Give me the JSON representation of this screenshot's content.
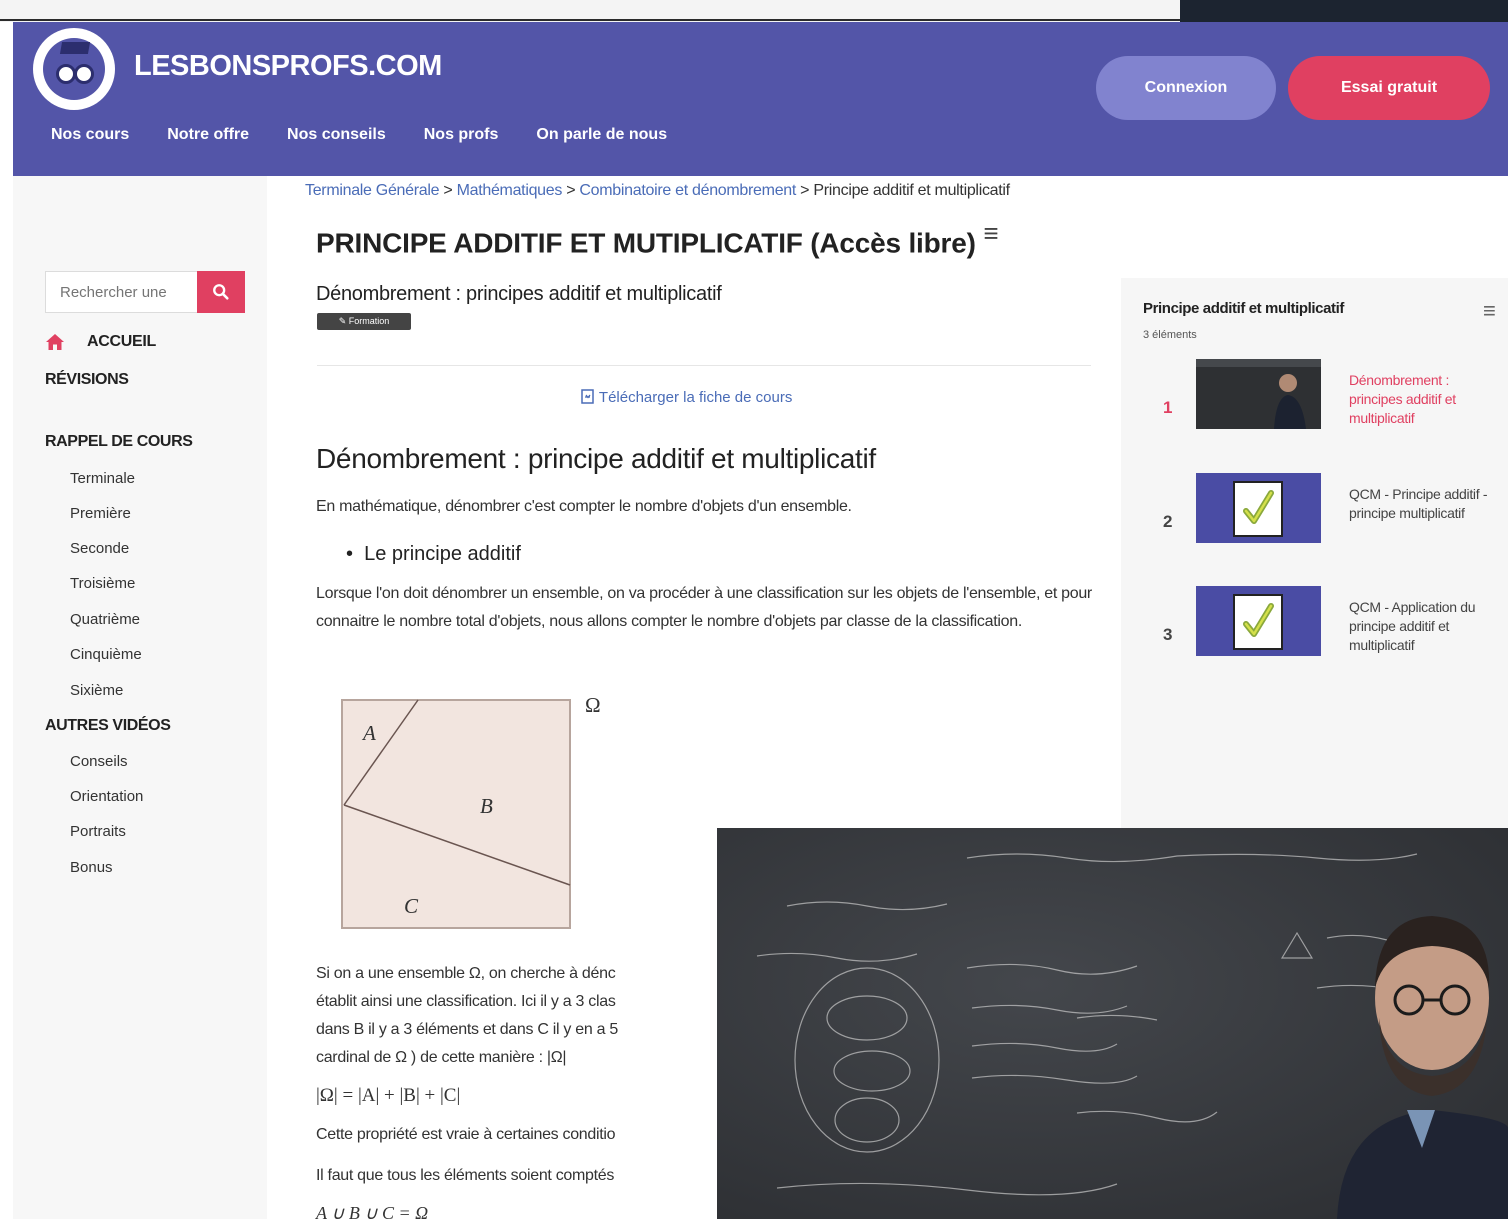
{
  "header": {
    "logo_text": "LESBONSPROFS.COM",
    "nav": [
      "Nos cours",
      "Notre offre",
      "Nos conseils",
      "Nos profs",
      "On parle de nous"
    ],
    "login_label": "Connexion",
    "trial_label": "Essai gratuit"
  },
  "sidebar": {
    "search_placeholder": "Rechercher une",
    "home_label": "ACCUEIL",
    "revisions": "RÉVISIONS",
    "rappel": "RAPPEL DE COURS",
    "levels": [
      "Terminale",
      "Première",
      "Seconde",
      "Troisième",
      "Quatrième",
      "Cinquième",
      "Sixième"
    ],
    "autres": "AUTRES VIDÉOS",
    "others": [
      "Conseils",
      "Orientation",
      "Portraits",
      "Bonus"
    ]
  },
  "breadcrumb": {
    "items": [
      "Terminale Générale",
      "Mathématiques",
      "Combinatoire et dénombrement"
    ],
    "current": "Principe additif et multiplicatif",
    "sep": " > "
  },
  "main": {
    "title": "PRINCIPE ADDITIF ET MUTIPLICATIF (Accès libre)",
    "title_menu": "≡",
    "video_title": "Dénombrement : principes additif et multiplicatif",
    "badge": "✎ Formation",
    "download": "Télécharger la fiche de cours",
    "h2": "Dénombrement : principe additif et multiplicatif",
    "p1": "En mathématique, dénombrer c'est compter le nombre d'objets d'un ensemble.",
    "bullet": "Le principe additif",
    "para": "Lorsque l'on doit dénombrer un ensemble, on va procéder à une classification sur les objets de l'ensemble, et pour connaitre le nombre total d'objets, nous allons compter le nombre d'objets par classe de la classification.",
    "para2": [
      "Si on a une ensemble Ω, on cherche à dénc",
      "établit ainsi une classification. Ici il y a 3 clas",
      "dans B il y a 3 éléments et dans C il y en a 5",
      "cardinal de Ω ) de cette manière : |Ω|"
    ],
    "formula": "|Ω| = |A| + |B| + |C|",
    "line3": "Cette propriété est vraie à certaines conditio",
    "line4": "Il faut que tous les éléments soient comptés",
    "line5": "A ∪ B ∪ C = Ω"
  },
  "diagram": {
    "omega": "Ω",
    "labels": {
      "a": "A",
      "b": "B",
      "c": "C"
    }
  },
  "playlist": {
    "title": "Principe additif et multiplicatif",
    "count": "3 éléments",
    "menu": "≡",
    "items": [
      {
        "num": "1",
        "label": "Dénombrement : principes additif et multiplicatif",
        "active": true
      },
      {
        "num": "2",
        "label": "QCM - Principe additif - principe multiplicatif",
        "active": false
      },
      {
        "num": "3",
        "label": "QCM - Application du principe additif et multiplicatif",
        "active": false
      }
    ]
  },
  "colors": {
    "header": "#5355a8",
    "accent": "#e04061",
    "link": "#4a6cb7"
  }
}
